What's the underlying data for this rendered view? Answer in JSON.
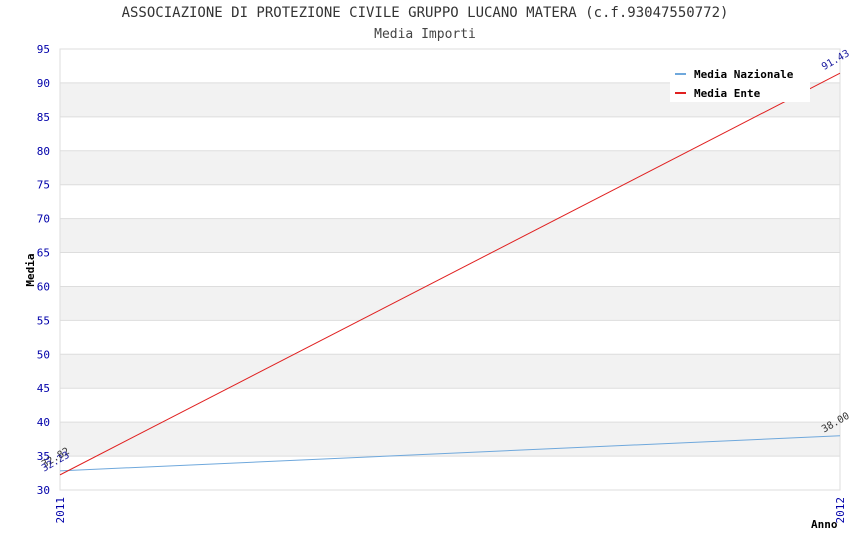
{
  "chart_data": {
    "type": "line",
    "title": "ASSOCIAZIONE DI PROTEZIONE CIVILE GRUPPO LUCANO MATERA (c.f.93047550772)",
    "subtitle": "Media Importi",
    "xlabel": "Anno",
    "ylabel": "Media",
    "x": [
      "2011",
      "2012"
    ],
    "ylim": [
      30,
      95
    ],
    "yticks": [
      30,
      35,
      40,
      45,
      50,
      55,
      60,
      65,
      70,
      75,
      80,
      85,
      90,
      95
    ],
    "grid": true,
    "legend_position": "top-right",
    "series": [
      {
        "name": "Media Nazionale",
        "color": "#6fa8dc",
        "values": [
          32.82,
          38.0
        ],
        "labels": [
          "32.82",
          "38.00"
        ],
        "label_color": "#333333"
      },
      {
        "name": "Media Ente",
        "color": "#e02020",
        "values": [
          32.23,
          91.43
        ],
        "labels": [
          "32.23",
          "91.43"
        ],
        "label_color": "#1a1aa0"
      }
    ],
    "colors": {
      "axis_text": "#0000aa",
      "band": "#f2f2f2",
      "grid": "#dddddd"
    }
  }
}
